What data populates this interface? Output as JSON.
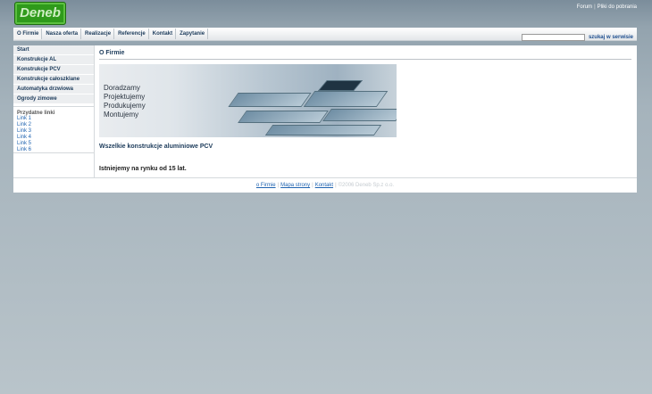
{
  "header": {
    "logo_text": "Deneb",
    "links": [
      "Forum",
      "Pliki do pobrania"
    ]
  },
  "nav": {
    "items": [
      "O Firmie",
      "Nasza oferta",
      "Realizacje",
      "Referencje",
      "Kontakt",
      "Zapytanie"
    ],
    "search_button": "szukaj w serwisie",
    "search_value": ""
  },
  "sidebar": {
    "items": [
      "Start",
      "Konstrukcje AL",
      "Konstrukcje PCV",
      "Konstrukcje całoszklane",
      "Automatyka drzwiowa",
      "Ogrody zimowe"
    ],
    "links_heading": "Przydatne linki",
    "links": [
      "Link 1",
      "Link 2",
      "Link 3",
      "Link 4",
      "Link 5",
      "Link 6"
    ]
  },
  "content": {
    "title": "O Firmie",
    "slogans": [
      "Doradzamy",
      "Projektujemy",
      "Produkujemy",
      "Montujemy"
    ],
    "line1": "Wszelkie konstrukcje aluminiowe PCV",
    "line2": "Istniejemy na rynku od 15 lat."
  },
  "footer": {
    "links": [
      "o Firmie",
      "Mapa strony",
      "Kontakt"
    ],
    "copyright": "©2006 Deneb Sp.z o.o."
  },
  "colors": {
    "accent": "#1b3a5a",
    "link": "#1f63b0",
    "logo": "#2f9a1b"
  }
}
